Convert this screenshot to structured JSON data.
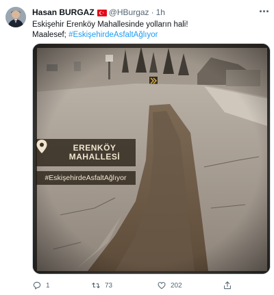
{
  "author": {
    "name": "Hasan BURGAZ",
    "handle": "@HBurgaz",
    "separator": "·",
    "time": "1h"
  },
  "tweet": {
    "line1": "Eskişehir Erenköy Mahallesinde yolların hali!",
    "line2_prefix": "Maalesef; ",
    "hashtag": "#EskişehirdeAsfaltAğlıyor"
  },
  "media": {
    "location_label_line1": "ERENKÖY",
    "location_label_line2": "MAHALLESİ",
    "hashtag_overlay": "#EskişehirdeAsfaltAğlıyor"
  },
  "actions": {
    "replies": "1",
    "retweets": "73",
    "likes": "202"
  },
  "colors": {
    "text": "#0f1419",
    "secondary": "#536471",
    "link": "#1d9bf0",
    "overlay_text": "#f0e6cf"
  }
}
